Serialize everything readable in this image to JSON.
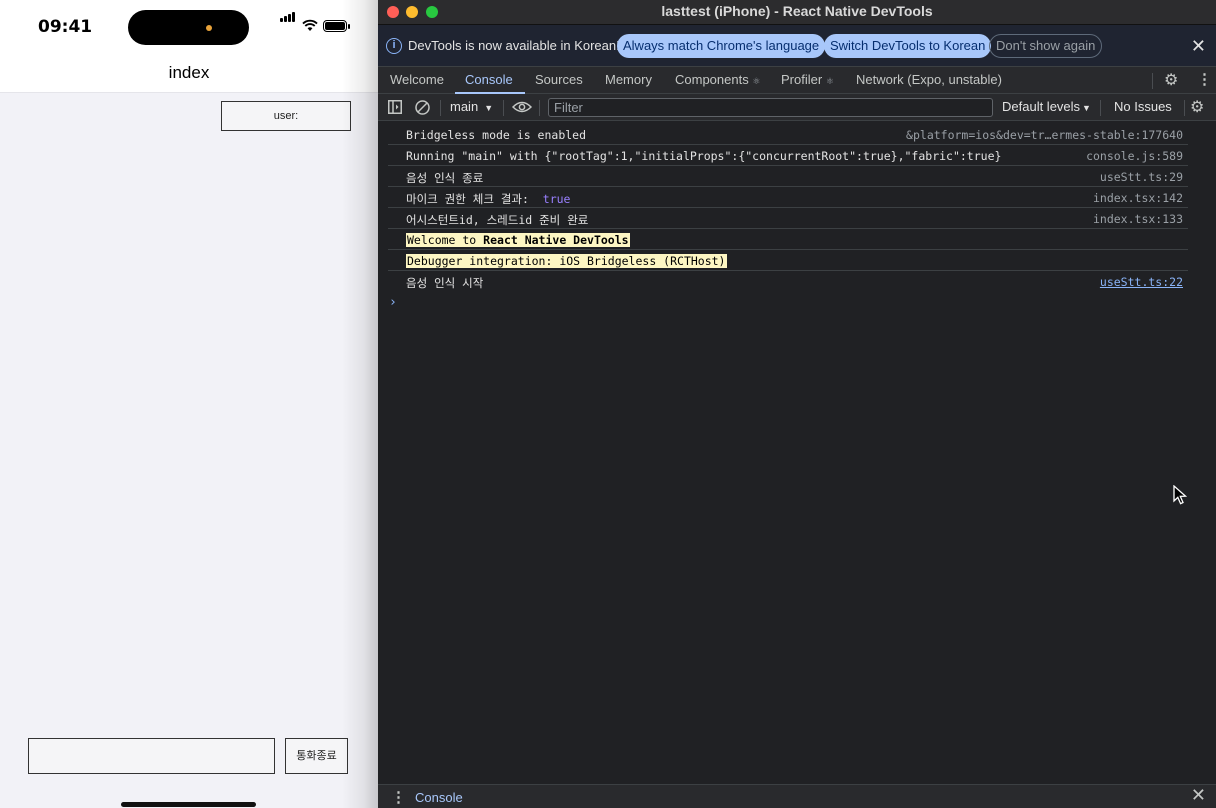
{
  "phone": {
    "status_time": "09:41",
    "nav_title": "index",
    "user_label": "user:",
    "message_input_value": "",
    "end_call_label": "통화종료"
  },
  "devtools": {
    "window_title": "lasttest (iPhone) - React Native DevTools",
    "infobar": {
      "text": "DevTools is now available in Korean!",
      "match_language": "Always match Chrome's language",
      "switch_language": "Switch DevTools to Korean",
      "dismiss": "Don't show again"
    },
    "tabs": [
      {
        "label": "Welcome"
      },
      {
        "label": "Console",
        "active": true
      },
      {
        "label": "Sources"
      },
      {
        "label": "Memory"
      },
      {
        "label": "Components",
        "icon": "react-icon"
      },
      {
        "label": "Profiler",
        "icon": "react-icon"
      },
      {
        "label": "Network (Expo, unstable)"
      }
    ],
    "toolbar": {
      "context": "main",
      "filter_placeholder": "Filter",
      "levels": "Default levels",
      "issues": "No Issues"
    },
    "console_rows": [
      {
        "message": "Bridgeless mode is enabled",
        "source": "&platform=ios&dev=tr…ermes-stable:177640"
      },
      {
        "message": "Running \"main\" with {\"rootTag\":1,\"initialProps\":{\"concurrentRoot\":true},\"fabric\":true}",
        "source": "console.js:589"
      },
      {
        "message": "음성 인식 종료",
        "source": "useStt.ts:29"
      },
      {
        "message": "마이크 권한 체크 결과:",
        "value": "true",
        "source": "index.tsx:142"
      },
      {
        "message": "어시스턴트id, 스레드id 준비 완료",
        "source": "index.tsx:133"
      },
      {
        "message_prefix": "Welcome to ",
        "message_bold": "React Native DevTools",
        "source": ""
      },
      {
        "message": "Debugger integration: iOS Bridgeless (RCTHost)",
        "source": ""
      },
      {
        "message": "음성 인식 시작",
        "source": "useStt.ts:22",
        "source_link": true
      }
    ],
    "drawer_tab": "Console",
    "colors": {
      "background": "#202124",
      "accent": "#a8c7fa",
      "link": "#8ab4f8",
      "boolean": "#9980ff"
    }
  }
}
